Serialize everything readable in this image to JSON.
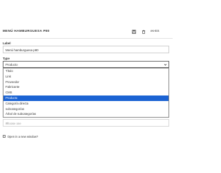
{
  "header": {
    "title": "MENÚ HAMBURGUESA P80",
    "language": "es-ES",
    "icons": [
      "save-icon",
      "trash-icon",
      "language-icon"
    ]
  },
  "label_field": {
    "label": "Label",
    "value": "Menú hamburguesa p80"
  },
  "type_field": {
    "label": "Type",
    "selected": "Producto",
    "options": [
      "Título",
      "Link",
      "Proveedor",
      "Fabricante",
      "CMS",
      "Producto",
      "Categoría directa",
      "subcategorías",
      "Árbol de subcategorías"
    ],
    "selected_index": 5
  },
  "secondary_select": {
    "placeholder": "Choose one"
  },
  "new_window": {
    "label": "Open in a new window?",
    "checked": false
  },
  "colors": {
    "selected_bg": "#1b63d3",
    "border": "#cfcfcf",
    "text": "#333333"
  }
}
